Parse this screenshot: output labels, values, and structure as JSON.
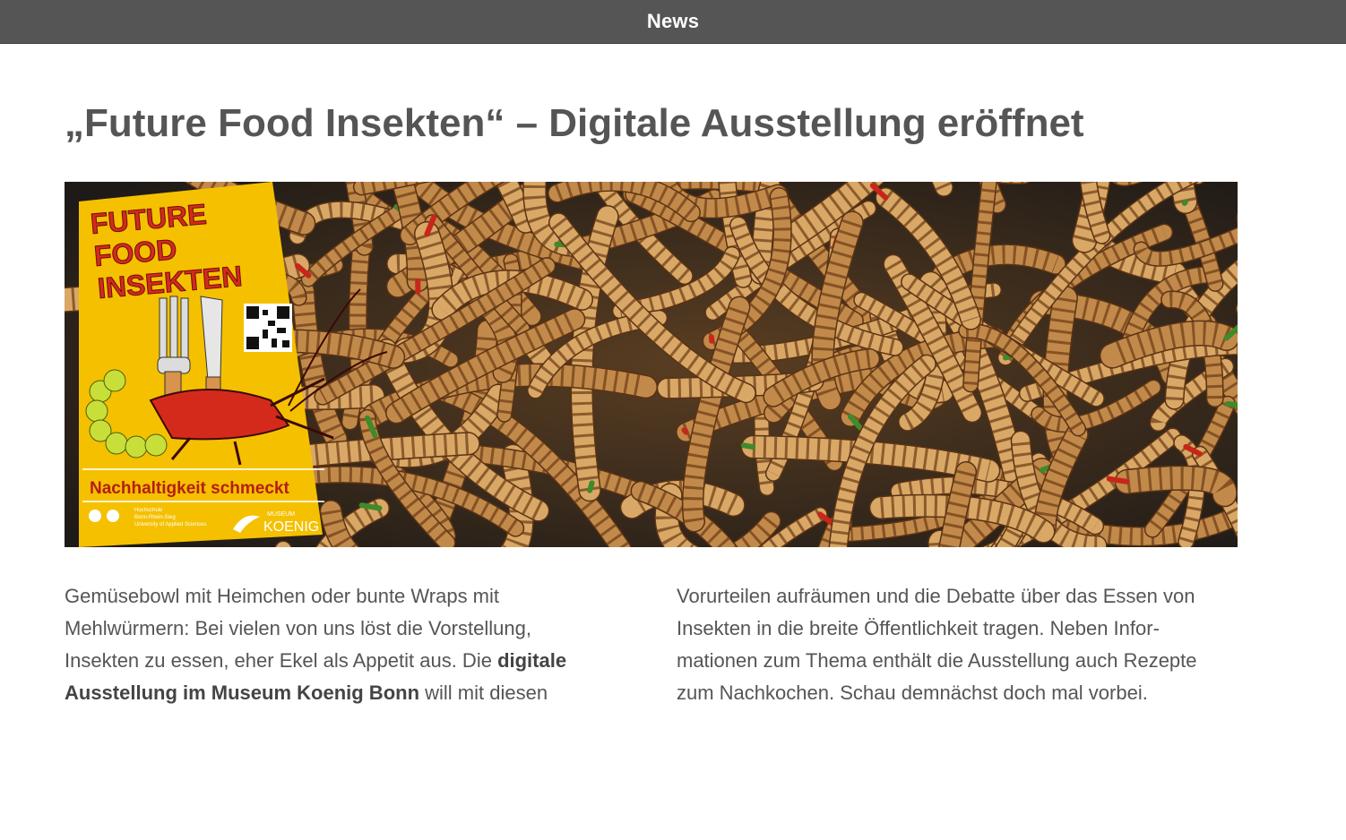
{
  "header": {
    "title": "News"
  },
  "article": {
    "title": "„Future Food Insekten“ – Digitale Ausstellung eröffnet",
    "poster": {
      "title_line1": "FUTURE",
      "title_line2": "FOOD",
      "title_line3": "INSEKTEN",
      "tagline": "Nachhaltigkeit schmeckt",
      "logo_left_line1": "Hochschule",
      "logo_left_line2": "Bonn-Rhein-Sieg",
      "logo_left_line3": "University of Applied Sciences",
      "logo_right_line1": "MUSEUM",
      "logo_right_line2": "KOENIG"
    },
    "body_left_1": "Gemüsebowl mit Heimchen oder bunte Wraps mit Mehlwürmern: Bei vielen von uns löst die Vorstellung, Insekten zu essen, eher Ekel als Appetit aus. Die ",
    "body_left_bold": "digitale Ausstellung im Museum Koenig Bonn",
    "body_left_2": " will mit diesen",
    "body_right": "Vorurteilen aufräumen und die Debatte über das Essen von Insekten in die breite Öffentlichkeit tragen. Neben Infor­mationen zum Thema enthält die Ausstellung auch Rezepte zum Nachkochen. Schau demnächst doch mal vorbei."
  },
  "colors": {
    "header_bg": "#555555",
    "poster_yellow": "#f5c000",
    "poster_red": "#d42a1c",
    "text": "#555555"
  }
}
